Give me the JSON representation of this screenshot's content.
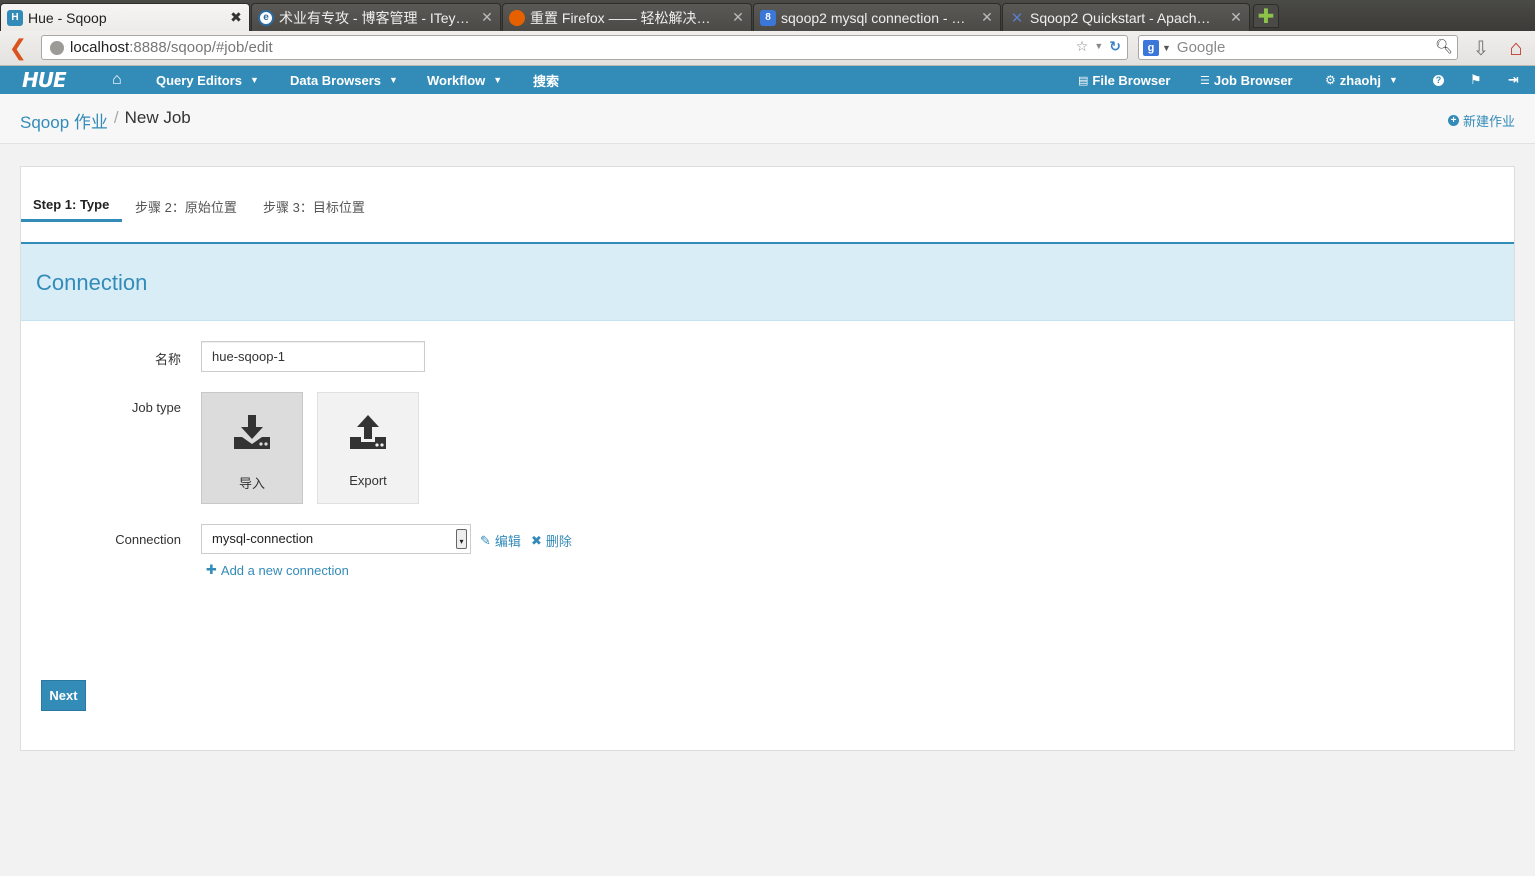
{
  "browser": {
    "tabs": [
      {
        "title": "Hue - Sqoop",
        "favicon": "hue-favicon",
        "active": true
      },
      {
        "title": "术业有专攻 - 博客管理 - ITey…",
        "favicon": "iteye-favicon",
        "active": false
      },
      {
        "title": "重置 Firefox —— 轻松解决…",
        "favicon": "firefox-favicon",
        "active": false
      },
      {
        "title": "sqoop2 mysql connection - …",
        "favicon": "google-favicon",
        "active": false
      },
      {
        "title": "Sqoop2 Quickstart - Apach…",
        "favicon": "apache-favicon",
        "active": false
      }
    ],
    "url_host": "localhost",
    "url_path": ":8888/sqoop/#job/edit",
    "search_placeholder": "Google",
    "search_engine_letter": "g"
  },
  "hue_nav": {
    "logo": "HUE",
    "home_icon": "home-icon",
    "items": [
      {
        "label": "Query Editors",
        "dropdown": true
      },
      {
        "label": "Data Browsers",
        "dropdown": true
      },
      {
        "label": "Workflow",
        "dropdown": true
      },
      {
        "label": "搜索",
        "dropdown": false
      }
    ],
    "right_items": [
      {
        "label": "File Browser",
        "icon": "file-icon"
      },
      {
        "label": "Job Browser",
        "icon": "list-icon"
      },
      {
        "label": "zhaohj",
        "icon": "gears-icon",
        "dropdown": true
      }
    ],
    "right_icons": [
      "help-icon",
      "flag-icon",
      "logout-icon"
    ]
  },
  "header": {
    "breadcrumb_root": "Sqoop 作业",
    "breadcrumb_sep": "/",
    "breadcrumb_current": "New Job",
    "new_job_label": "新建作业"
  },
  "steps": [
    {
      "label": "Step 1: Type",
      "active": true
    },
    {
      "label": "步骤 2：原始位置",
      "active": false
    },
    {
      "label": "步骤 3：目标位置",
      "active": false
    }
  ],
  "section_title": "Connection",
  "form": {
    "name_label": "名称",
    "name_value": "hue-sqoop-1",
    "job_type_label": "Job type",
    "job_types": [
      {
        "label": "导入",
        "icon": "import-icon",
        "selected": true
      },
      {
        "label": "Export",
        "icon": "export-icon",
        "selected": false
      }
    ],
    "connection_label": "Connection",
    "connection_value": "mysql-connection",
    "edit_label": "编辑",
    "delete_label": "删除",
    "add_connection_label": "Add a new connection"
  },
  "next_label": "Next",
  "colors": {
    "accent": "#338bb8",
    "section_bg": "#d9edf7"
  }
}
